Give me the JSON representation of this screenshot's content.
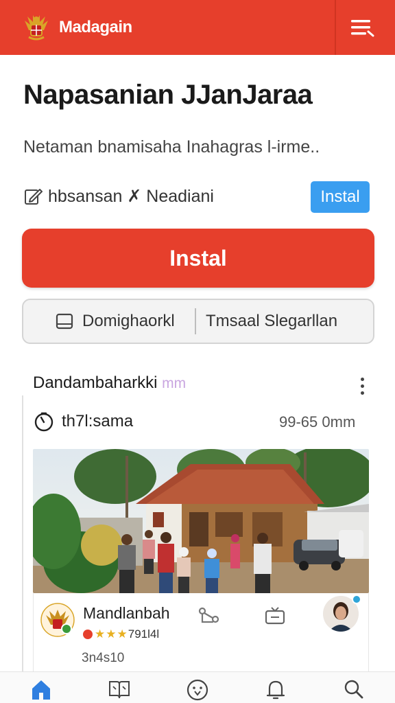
{
  "header": {
    "app_title": "Madagain",
    "logo_icon": "garuda-emblem-icon",
    "menu_icon": "hamburger-menu-icon",
    "color": "#e63f2c"
  },
  "page": {
    "title": "Napasanian JJanJaraa",
    "subtitle": "Netaman bnamisaha Inahagras  l-irme.."
  },
  "meta": {
    "edit_icon": "edit-icon",
    "text": "hbsansan  ✗  Neadiani",
    "small_install_label": "Instal",
    "small_install_color": "#3a9ef0"
  },
  "actions": {
    "install_label": "Instal",
    "bookmark_label": "Domighaorkl",
    "secondary_label": "Tmsaal Slegarllan"
  },
  "card": {
    "title": "Dandambaharkki",
    "title_suffix": "mm",
    "time_label": "th7l:sama",
    "time_value": "99-65 0mm",
    "org_name": "Mandlanbah",
    "rating_text": "791l4l",
    "count_text": "3n4s10"
  },
  "nav": {
    "items": [
      "home-icon",
      "book-icon",
      "face-icon",
      "bell-icon",
      "search-icon"
    ],
    "active_color": "#2f7fe0"
  }
}
